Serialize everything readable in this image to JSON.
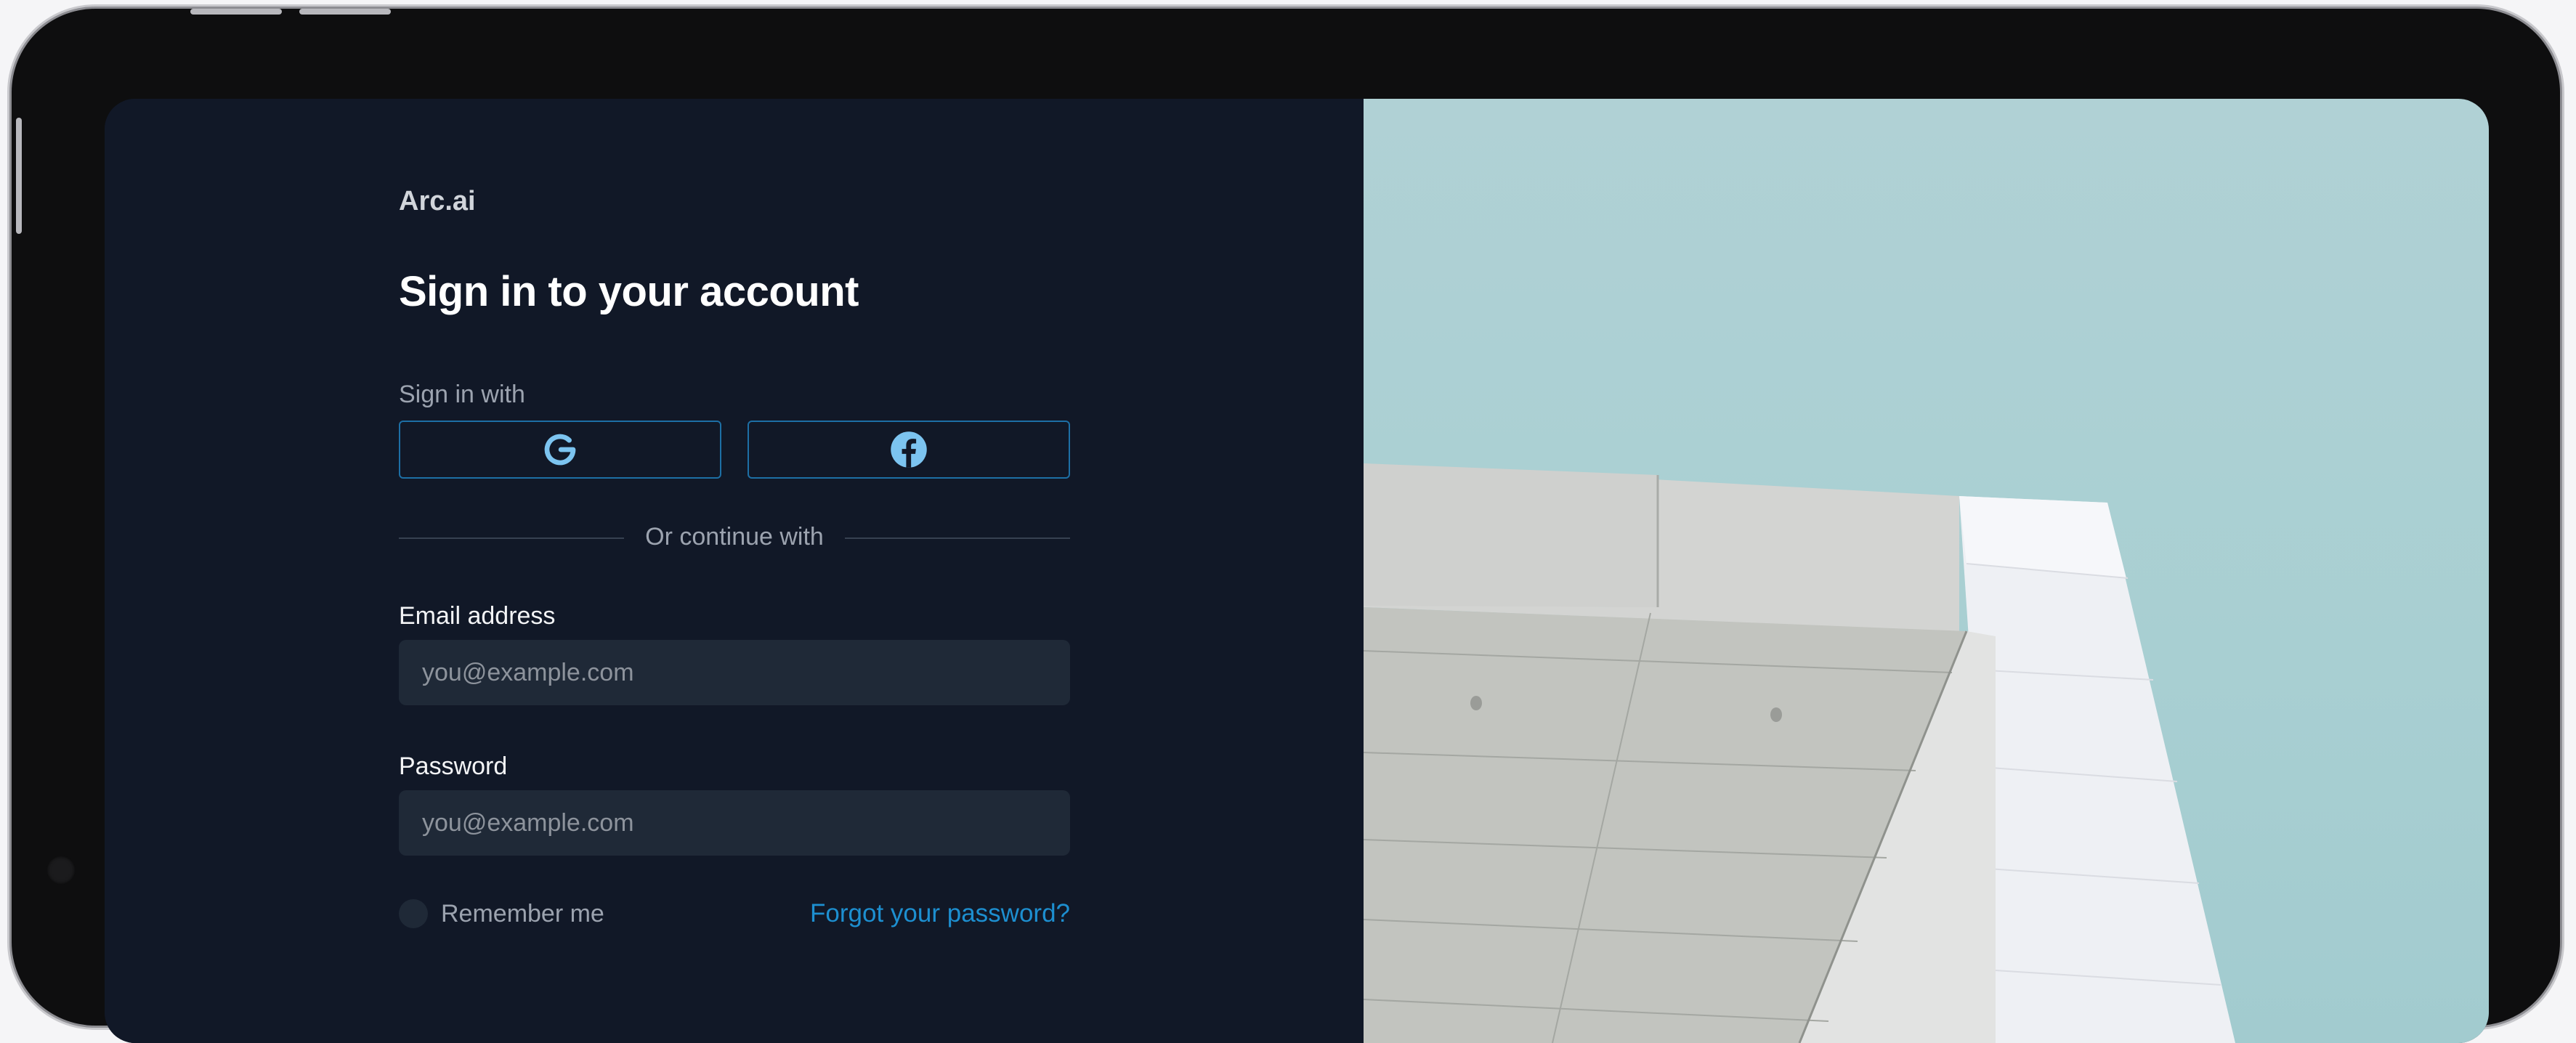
{
  "brand": {
    "name": "Arc.ai"
  },
  "heading": "Sign in to your account",
  "social": {
    "label": "Sign in with",
    "providers": [
      {
        "name": "google",
        "icon": "google-icon"
      },
      {
        "name": "facebook",
        "icon": "facebook-icon"
      }
    ]
  },
  "divider": "Or continue with",
  "email": {
    "label": "Email address",
    "placeholder": "you@example.com"
  },
  "password": {
    "label": "Password",
    "placeholder": "you@example.com"
  },
  "remember": {
    "label": "Remember me",
    "checked": false
  },
  "forgot": {
    "label": "Forgot your password?"
  },
  "colors": {
    "background": "#111827",
    "input": "#1f2937",
    "accent": "#1d8fd0",
    "sky": "#a8cfd2"
  }
}
